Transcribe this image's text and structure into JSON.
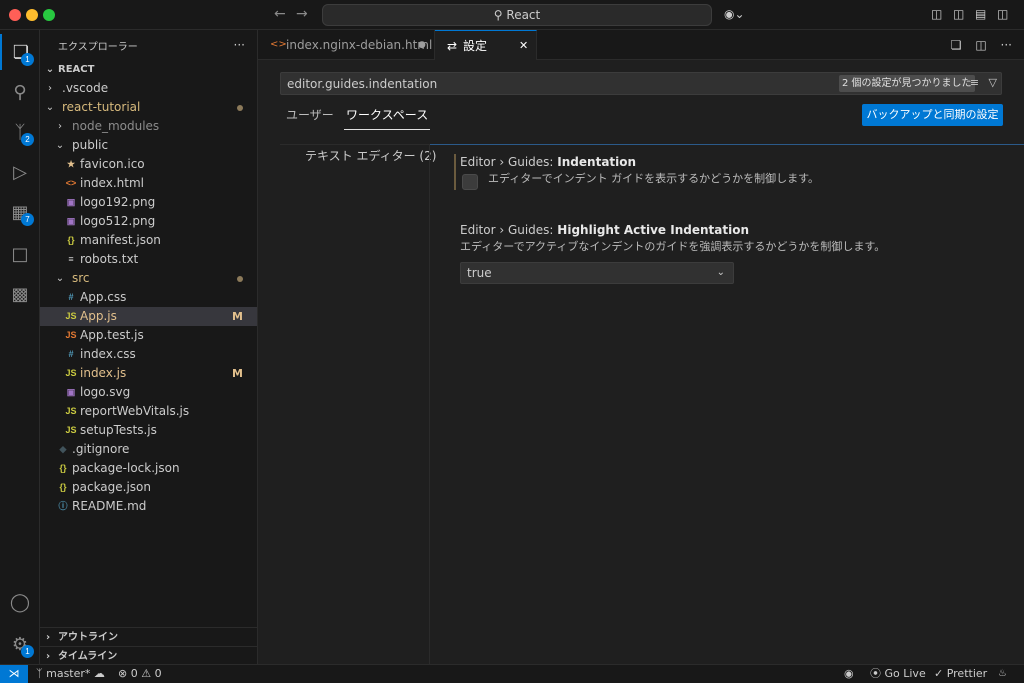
{
  "titlebar": {
    "search_text": "React",
    "back_icon": "arrow-left-icon",
    "forward_icon": "arrow-right-icon"
  },
  "activity_bar": {
    "items": [
      {
        "name": "explorer",
        "badge": "1"
      },
      {
        "name": "search",
        "badge": ""
      },
      {
        "name": "source-control",
        "badge": "2"
      },
      {
        "name": "run-debug",
        "badge": ""
      },
      {
        "name": "extensions",
        "badge": "7"
      },
      {
        "name": "remote-explorer",
        "badge": ""
      },
      {
        "name": "docker",
        "badge": ""
      }
    ],
    "accounts_badge": "",
    "manage_badge": "1"
  },
  "sidebar": {
    "title": "エクスプローラー",
    "more": "···",
    "root": "REACT",
    "tree": [
      {
        "label": ".vscode",
        "type": "folder",
        "depth": 1,
        "open": false,
        "mark": "",
        "icon": "",
        "color": "#cccccc"
      },
      {
        "label": "react-tutorial",
        "type": "folder",
        "depth": 1,
        "open": true,
        "mark": "dot",
        "icon": "",
        "color": "#d7ba7d"
      },
      {
        "label": "node_modules",
        "type": "folder",
        "depth": 2,
        "open": false,
        "mark": "",
        "icon": "",
        "color": "#8c8c8c"
      },
      {
        "label": "public",
        "type": "folder",
        "depth": 2,
        "open": true,
        "mark": "",
        "icon": "",
        "color": "#cccccc"
      },
      {
        "label": "favicon.ico",
        "type": "file",
        "depth": 3,
        "mark": "",
        "icon": "★",
        "icon_color": "#e2c08d",
        "color": "#cccccc"
      },
      {
        "label": "index.html",
        "type": "file",
        "depth": 3,
        "mark": "",
        "icon": "<>",
        "icon_color": "#e37933",
        "color": "#cccccc"
      },
      {
        "label": "logo192.png",
        "type": "file",
        "depth": 3,
        "mark": "",
        "icon": "▣",
        "icon_color": "#a074c4",
        "color": "#cccccc"
      },
      {
        "label": "logo512.png",
        "type": "file",
        "depth": 3,
        "mark": "",
        "icon": "▣",
        "icon_color": "#a074c4",
        "color": "#cccccc"
      },
      {
        "label": "manifest.json",
        "type": "file",
        "depth": 3,
        "mark": "",
        "icon": "{}",
        "icon_color": "#cbcb41",
        "color": "#cccccc"
      },
      {
        "label": "robots.txt",
        "type": "file",
        "depth": 3,
        "mark": "",
        "icon": "≡",
        "icon_color": "#cccccc",
        "color": "#cccccc"
      },
      {
        "label": "src",
        "type": "folder",
        "depth": 2,
        "open": true,
        "mark": "dot",
        "icon": "",
        "color": "#d7ba7d"
      },
      {
        "label": "App.css",
        "type": "file",
        "depth": 3,
        "mark": "",
        "icon": "#",
        "icon_color": "#519aba",
        "color": "#cccccc"
      },
      {
        "label": "App.js",
        "type": "file",
        "depth": 3,
        "mark": "M",
        "icon": "JS",
        "icon_color": "#cbcb41",
        "color": "#e2c08d",
        "selected": true
      },
      {
        "label": "App.test.js",
        "type": "file",
        "depth": 3,
        "mark": "",
        "icon": "JS",
        "icon_color": "#e37933",
        "color": "#cccccc"
      },
      {
        "label": "index.css",
        "type": "file",
        "depth": 3,
        "mark": "",
        "icon": "#",
        "icon_color": "#519aba",
        "color": "#cccccc"
      },
      {
        "label": "index.js",
        "type": "file",
        "depth": 3,
        "mark": "M",
        "icon": "JS",
        "icon_color": "#cbcb41",
        "color": "#e2c08d"
      },
      {
        "label": "logo.svg",
        "type": "file",
        "depth": 3,
        "mark": "",
        "icon": "▣",
        "icon_color": "#a074c4",
        "color": "#cccccc"
      },
      {
        "label": "reportWebVitals.js",
        "type": "file",
        "depth": 3,
        "mark": "",
        "icon": "JS",
        "icon_color": "#cbcb41",
        "color": "#cccccc"
      },
      {
        "label": "setupTests.js",
        "type": "file",
        "depth": 3,
        "mark": "",
        "icon": "JS",
        "icon_color": "#cbcb41",
        "color": "#cccccc"
      },
      {
        "label": ".gitignore",
        "type": "file",
        "depth": 2,
        "mark": "",
        "icon": "◆",
        "icon_color": "#41535b",
        "color": "#cccccc"
      },
      {
        "label": "package-lock.json",
        "type": "file",
        "depth": 2,
        "mark": "",
        "icon": "{}",
        "icon_color": "#cbcb41",
        "color": "#cccccc"
      },
      {
        "label": "package.json",
        "type": "file",
        "depth": 2,
        "mark": "",
        "icon": "{}",
        "icon_color": "#cbcb41",
        "color": "#cccccc"
      },
      {
        "label": "README.md",
        "type": "file",
        "depth": 2,
        "mark": "",
        "icon": "ⓘ",
        "icon_color": "#519aba",
        "color": "#cccccc"
      }
    ],
    "outline_label": "アウトライン",
    "timeline_label": "タイムライン"
  },
  "tabs": [
    {
      "label": "index.nginx-debian.html",
      "icon": "<>",
      "modified_marker": "●",
      "active": false
    },
    {
      "label": "設定",
      "icon": "⇄",
      "close": "✕",
      "active": true
    }
  ],
  "settings": {
    "search_value": "editor.guides.indentation",
    "found_count": "2 個の設定が見つかりました",
    "scope_tabs": [
      "ユーザー",
      "ワークスペース"
    ],
    "sync_button": "バックアップと同期の設定",
    "toc_item": "テキスト エディター (2)",
    "items": [
      {
        "category": "Editor › Guides: ",
        "name": "Indentation",
        "description": "エディターでインデント ガイドを表示するかどうかを制御します。",
        "control": "checkbox",
        "checked": false
      },
      {
        "category": "Editor › Guides: ",
        "name": "Highlight Active Indentation",
        "description": "エディターでアクティブなインデントのガイドを強調表示するかどうかを制御します。",
        "control": "select",
        "value": "true"
      }
    ]
  },
  "statusbar": {
    "remote": "⋊",
    "branch": "master*",
    "problems": "⊗ 0 ⚠ 0",
    "go_live": "Go Live",
    "prettier": "✓ Prettier",
    "bell": "🔔"
  },
  "colors": {
    "accent": "#0078d4",
    "modified": "#e2c08d"
  }
}
